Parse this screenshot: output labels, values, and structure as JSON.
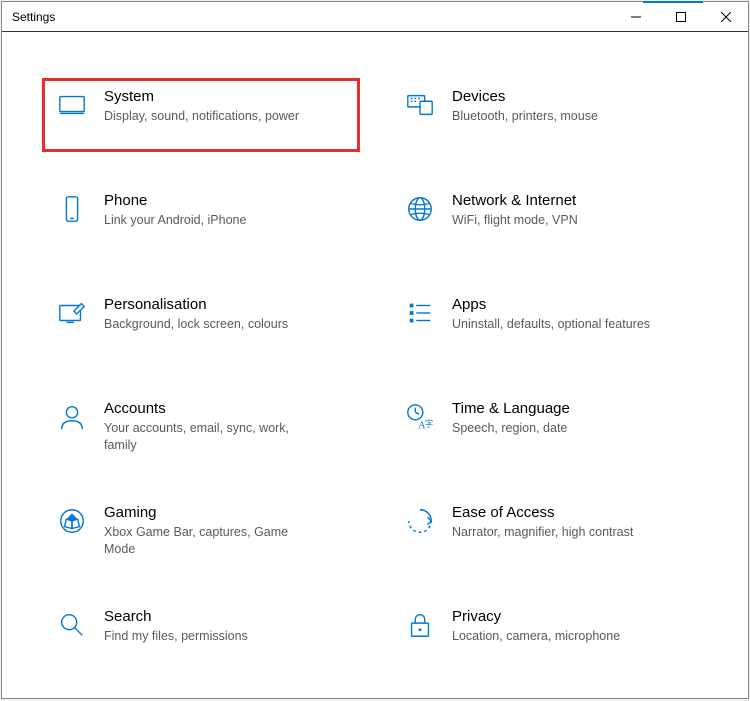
{
  "window": {
    "title": "Settings"
  },
  "tiles": [
    {
      "title": "System",
      "desc": "Display, sound, notifications, power",
      "highlight": true
    },
    {
      "title": "Devices",
      "desc": "Bluetooth, printers, mouse"
    },
    {
      "title": "Phone",
      "desc": "Link your Android, iPhone"
    },
    {
      "title": "Network & Internet",
      "desc": "WiFi, flight mode, VPN"
    },
    {
      "title": "Personalisation",
      "desc": "Background, lock screen, colours"
    },
    {
      "title": "Apps",
      "desc": "Uninstall, defaults, optional features"
    },
    {
      "title": "Accounts",
      "desc": "Your accounts, email, sync, work, family"
    },
    {
      "title": "Time & Language",
      "desc": "Speech, region, date"
    },
    {
      "title": "Gaming",
      "desc": "Xbox Game Bar, captures, Game Mode"
    },
    {
      "title": "Ease of Access",
      "desc": "Narrator, magnifier, high contrast"
    },
    {
      "title": "Search",
      "desc": "Find my files, permissions"
    },
    {
      "title": "Privacy",
      "desc": "Location, camera, microphone"
    }
  ]
}
